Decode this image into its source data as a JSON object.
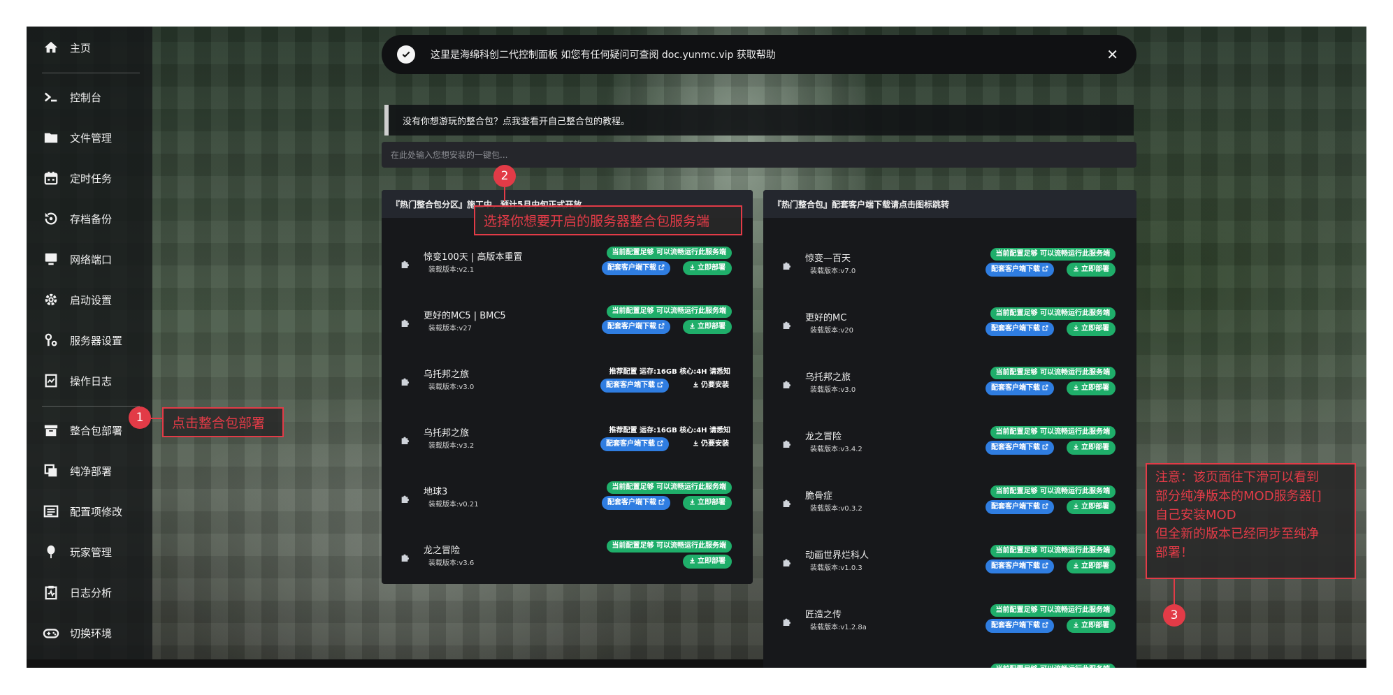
{
  "sidebar": {
    "items": [
      {
        "label": "主页",
        "icon": "home-icon"
      },
      {
        "label": "控制台",
        "icon": "terminal-icon"
      },
      {
        "label": "文件管理",
        "icon": "folder-icon"
      },
      {
        "label": "定时任务",
        "icon": "calendar-icon"
      },
      {
        "label": "存档备份",
        "icon": "backup-icon"
      },
      {
        "label": "网络端口",
        "icon": "monitor-icon"
      },
      {
        "label": "启动设置",
        "icon": "gear-icon"
      },
      {
        "label": "服务器设置",
        "icon": "wrench-icon"
      },
      {
        "label": "操作日志",
        "icon": "log-icon"
      },
      {
        "label": "整合包部署",
        "icon": "archive-icon"
      },
      {
        "label": "纯净部署",
        "icon": "copy-icon"
      },
      {
        "label": "配置项修改",
        "icon": "list-icon"
      },
      {
        "label": "玩家管理",
        "icon": "balloon-icon"
      },
      {
        "label": "日志分析",
        "icon": "clipboard-icon"
      },
      {
        "label": "切换环境",
        "icon": "gamepad-icon"
      }
    ]
  },
  "toast": {
    "text": "这里是海绵科创二代控制面板 如您有任何疑问可查阅 doc.yunmc.vip 获取帮助",
    "close": "✕"
  },
  "tip": "没有你想游玩的整合包？点我查看开自己整合包的教程。",
  "search": {
    "placeholder": "在此处输入您想安装的一键包..."
  },
  "left_panel": {
    "title": "『热门整合包分区』施工中，预计5月中旬正式开放",
    "rows": [
      {
        "name": "惊变100天 | 高版本重置",
        "version": "装载版本:v2.1",
        "status": "当前配置足够 可以流畅运行此服务端",
        "status_type": "ok",
        "client": "配套客户端下载",
        "action": "立即部署"
      },
      {
        "name": "更好的MC5 | BMC5",
        "version": "装载版本:v27",
        "status": "当前配置足够 可以流畅运行此服务端",
        "status_type": "ok",
        "client": "配套客户端下载",
        "action": "立即部署"
      },
      {
        "name": "乌托邦之旅",
        "version": "装载版本:v3.0",
        "status": "推荐配置 运存:16GB 核心:4H 请悉知",
        "status_type": "warn",
        "client": "配套客户端下载",
        "action": "仍要安装"
      },
      {
        "name": "乌托邦之旅",
        "version": "装载版本:v3.2",
        "status": "推荐配置 运存:16GB 核心:4H 请悉知",
        "status_type": "warn",
        "client": "配套客户端下载",
        "action": "仍要安装"
      },
      {
        "name": "地球3",
        "version": "装载版本:v0.21",
        "status": "当前配置足够 可以流畅运行此服务端",
        "status_type": "ok",
        "client": "配套客户端下载",
        "action": "立即部署"
      },
      {
        "name": "龙之冒险",
        "version": "装载版本:v3.6",
        "status": "当前配置足够 可以流畅运行此服务端",
        "status_type": "ok",
        "client": "",
        "action": "立即部署"
      }
    ]
  },
  "right_panel": {
    "title": "『热门整合包』配套客户端下载请点击图标跳转",
    "rows": [
      {
        "name": "惊变—百天",
        "version": "装载版本:v7.0",
        "status": "当前配置足够 可以流畅运行此服务端",
        "client": "配套客户端下载",
        "action": "立即部署"
      },
      {
        "name": "更好的MC",
        "version": "装载版本:v20",
        "status": "当前配置足够 可以流畅运行此服务端",
        "client": "配套客户端下载",
        "action": "立即部署"
      },
      {
        "name": "乌托邦之旅",
        "version": "装载版本:v3.0",
        "status": "当前配置足够 可以流畅运行此服务端",
        "client": "配套客户端下载",
        "action": "立即部署"
      },
      {
        "name": "龙之冒险",
        "version": "装载版本:v3.4.2",
        "status": "当前配置足够 可以流畅运行此服务端",
        "client": "配套客户端下载",
        "action": "立即部署"
      },
      {
        "name": "脆骨症",
        "version": "装载版本:v0.3.2",
        "status": "当前配置足够 可以流畅运行此服务端",
        "client": "配套客户端下载",
        "action": "立即部署"
      },
      {
        "name": "动画世界烂科人",
        "version": "装载版本:v1.0.3",
        "status": "当前配置足够 可以流畅运行此服务端",
        "client": "配套客户端下载",
        "action": "立即部署"
      },
      {
        "name": "匠造之传",
        "version": "装载版本:v1.2.8a",
        "status": "当前配置足够 可以流畅运行此服务端",
        "client": "配套客户端下载",
        "action": "立即部署"
      },
      {
        "name": "",
        "version": "",
        "status": "当前配置足够 可以流畅运行此服务端",
        "client": "",
        "action": ""
      }
    ]
  },
  "annotations": {
    "a1": {
      "num": "1",
      "text": "点击整合包部署"
    },
    "a2": {
      "num": "2",
      "text": "选择你想要开启的服务器整合包服务端"
    },
    "a3": {
      "num": "3",
      "lines": [
        "注意：该页面往下滑可以看到",
        "部分纯净版本的MOD服务器[]",
        "自己安装MOD",
        "但全新的版本已经同步至纯净",
        "部署！"
      ]
    }
  },
  "colors": {
    "accent_green": "#1fae6a",
    "accent_blue": "#2f7de1",
    "annotation_red": "#e23b47"
  }
}
